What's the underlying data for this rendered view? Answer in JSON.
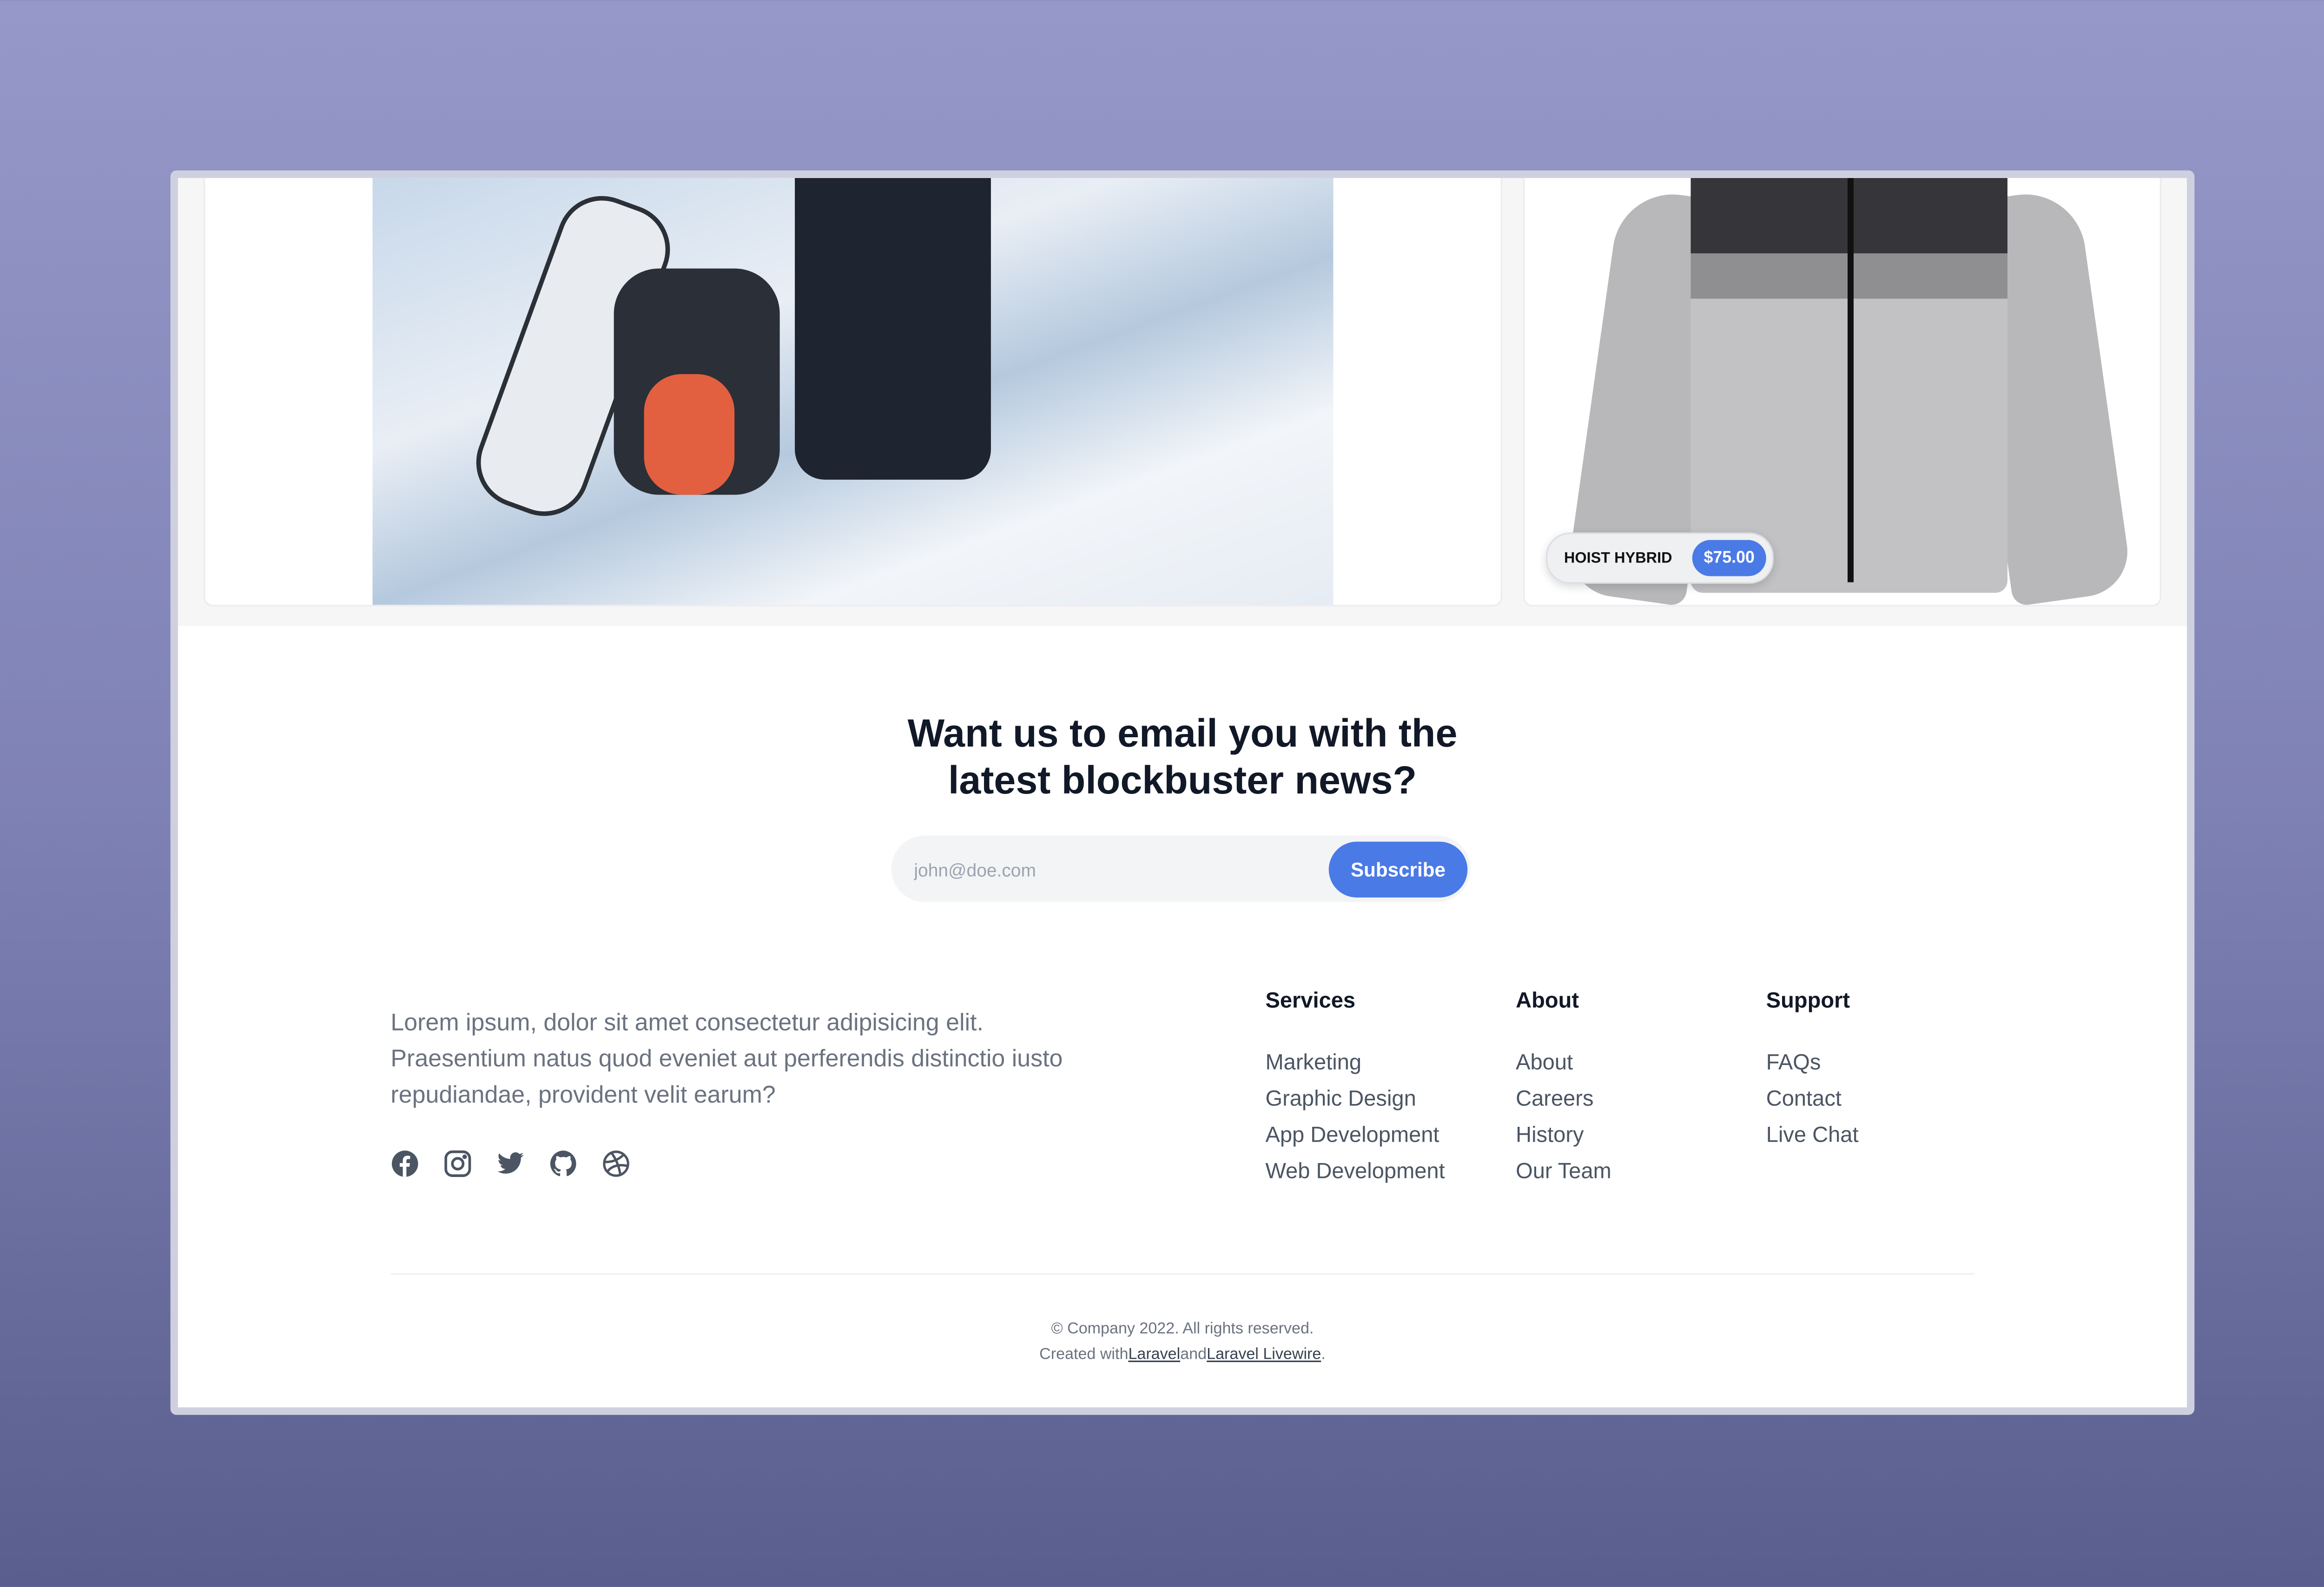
{
  "products": [
    {
      "name": "HOIST HYBRID",
      "price": "$75.00"
    }
  ],
  "newsletter": {
    "heading_line1": "Want us to email you with the",
    "heading_line2": "latest blockbuster news?",
    "email_placeholder": "john@doe.com",
    "subscribe_label": "Subscribe"
  },
  "footer": {
    "about": "Lorem ipsum, dolor sit amet consectetur adipisicing elit. Praesentium natus quod eveniet aut perferendis distinctio iusto repudiandae, provident velit earum?",
    "social": [
      "facebook-icon",
      "instagram-icon",
      "twitter-icon",
      "github-icon",
      "dribbble-icon"
    ],
    "columns": [
      {
        "title": "Services",
        "links": [
          "Marketing",
          "Graphic Design",
          "App Development",
          "Web Development"
        ]
      },
      {
        "title": "About",
        "links": [
          "About",
          "Careers",
          "History",
          "Our Team"
        ]
      },
      {
        "title": "Support",
        "links": [
          "FAQs",
          "Contact",
          "Live Chat"
        ]
      }
    ],
    "copyright": "© Company 2022. All rights reserved.",
    "created_prefix": "Created with",
    "created_link1": "Laravel",
    "created_and": "and",
    "created_link2": "Laravel Livewire",
    "created_suffix": "."
  },
  "colors": {
    "accent": "#4a7ae6",
    "heading": "#111827",
    "text": "#6b7280"
  }
}
